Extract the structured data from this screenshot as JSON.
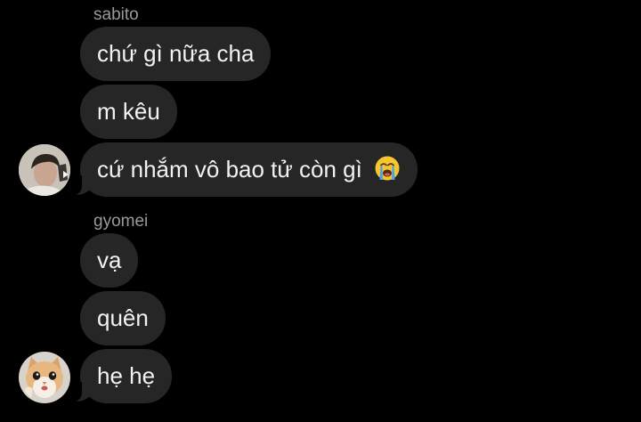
{
  "thread": {
    "groups": [
      {
        "sender": "sabito",
        "messages": [
          {
            "text": "chứ gì nữa cha"
          },
          {
            "text": "m kêu"
          },
          {
            "text": "cứ nhắm vô bao tử còn gì",
            "emoji": "loudly-crying-face"
          }
        ],
        "avatar": "dark-haired-person-photo"
      },
      {
        "sender": "gyomei",
        "messages": [
          {
            "text": "vạ"
          },
          {
            "text": "quên"
          },
          {
            "text": "hẹ hẹ"
          }
        ],
        "avatar": "cat-photo"
      }
    ]
  },
  "colors": {
    "background": "#000000",
    "bubble": "#262626",
    "bubble_text": "#f2f2f2",
    "sender_name": "#9a9a9a"
  }
}
